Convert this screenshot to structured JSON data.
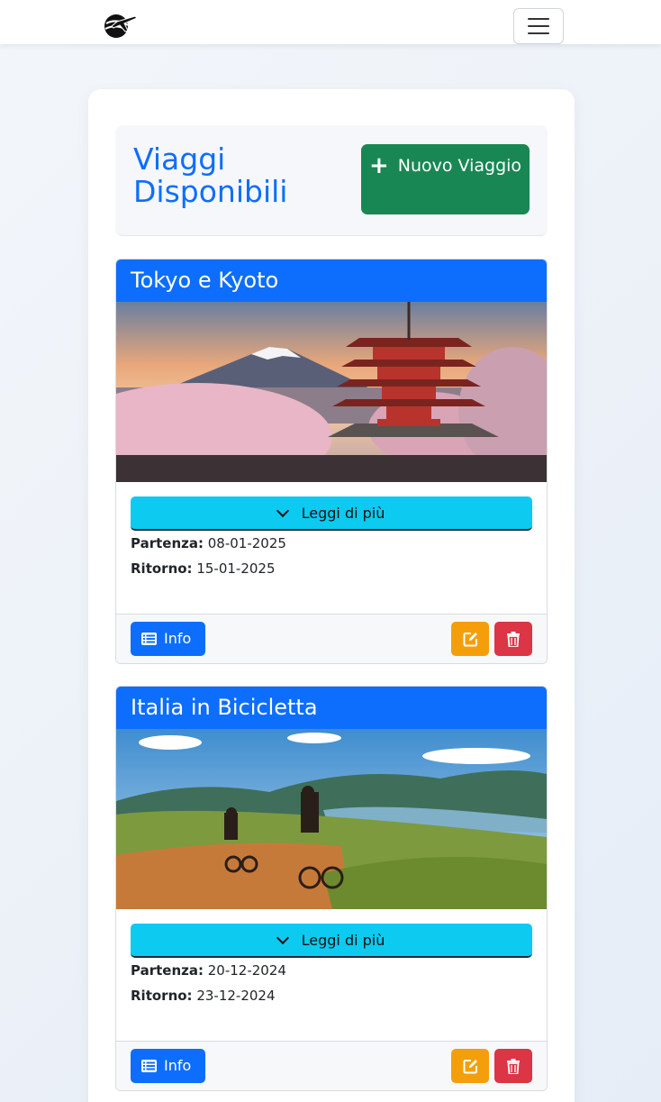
{
  "navbar": {
    "logo_icon": "airplane-globe-logo",
    "menu_icon": "hamburger-icon"
  },
  "header": {
    "title": "Viaggi Disponibili",
    "new_button_label": "Nuovo Viaggio",
    "new_button_icon": "plus-icon"
  },
  "colors": {
    "primary": "#0d6efd",
    "success": "#198754",
    "info": "#0dcaf0",
    "warning": "#f59e0b",
    "danger": "#dc3545"
  },
  "trips": [
    {
      "title": "Tokyo e Kyoto",
      "image_desc": "pagoda-mount-fuji-cherry-blossoms",
      "read_more_label": "Leggi di più",
      "departure_label": "Partenza:",
      "departure_date": "08-01-2025",
      "return_label": "Ritorno:",
      "return_date": "15-01-2025",
      "info_label": "Info"
    },
    {
      "title": "Italia in Bicicletta",
      "image_desc": "cyclists-countryside-dirt-road",
      "read_more_label": "Leggi di più",
      "departure_label": "Partenza:",
      "departure_date": "20-12-2024",
      "return_label": "Ritorno:",
      "return_date": "23-12-2024",
      "info_label": "Info"
    }
  ]
}
